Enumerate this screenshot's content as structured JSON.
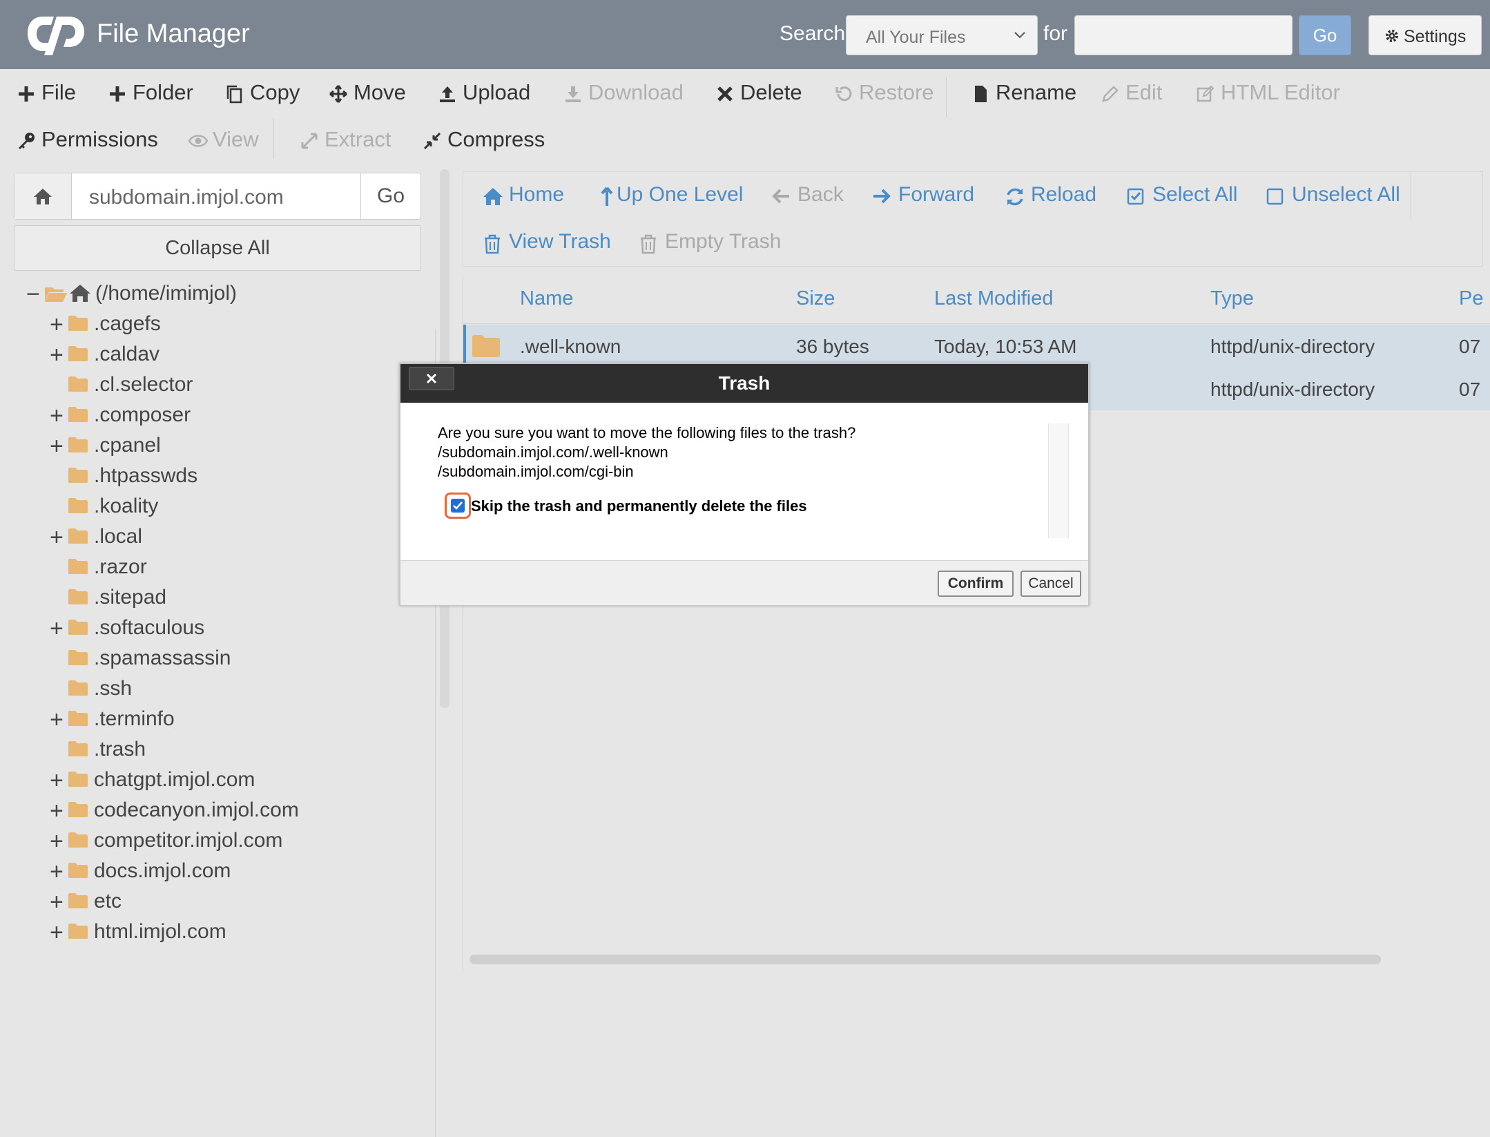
{
  "header": {
    "app_title": "File Manager",
    "search_label": "Search",
    "search_scope": "All Your Files",
    "for_label": "for",
    "search_value": "",
    "go_label": "Go",
    "settings_label": "Settings"
  },
  "toolbar": {
    "file": "File",
    "folder": "Folder",
    "copy": "Copy",
    "move": "Move",
    "upload": "Upload",
    "download": "Download",
    "delete": "Delete",
    "restore": "Restore",
    "rename": "Rename",
    "edit": "Edit",
    "html_editor": "HTML Editor",
    "permissions": "Permissions",
    "view": "View",
    "extract": "Extract",
    "compress": "Compress"
  },
  "sidebar": {
    "path_value": "subdomain.imjol.com",
    "go_label": "Go",
    "collapse_all": "Collapse All",
    "root_label": "(/home/imimjol)",
    "tree": [
      {
        "label": ".cagefs",
        "expandable": true
      },
      {
        "label": ".caldav",
        "expandable": true
      },
      {
        "label": ".cl.selector",
        "expandable": false
      },
      {
        "label": ".composer",
        "expandable": true
      },
      {
        "label": ".cpanel",
        "expandable": true
      },
      {
        "label": ".htpasswds",
        "expandable": false
      },
      {
        "label": ".koality",
        "expandable": false
      },
      {
        "label": ".local",
        "expandable": true
      },
      {
        "label": ".razor",
        "expandable": false
      },
      {
        "label": ".sitepad",
        "expandable": false
      },
      {
        "label": ".softaculous",
        "expandable": true
      },
      {
        "label": ".spamassassin",
        "expandable": false
      },
      {
        "label": ".ssh",
        "expandable": false
      },
      {
        "label": ".terminfo",
        "expandable": true
      },
      {
        "label": ".trash",
        "expandable": false
      },
      {
        "label": "chatgpt.imjol.com",
        "expandable": true
      },
      {
        "label": "codecanyon.imjol.com",
        "expandable": true
      },
      {
        "label": "competitor.imjol.com",
        "expandable": true
      },
      {
        "label": "docs.imjol.com",
        "expandable": true
      },
      {
        "label": "etc",
        "expandable": true
      },
      {
        "label": "html.imjol.com",
        "expandable": true
      }
    ]
  },
  "navbar": {
    "home": "Home",
    "up_one_level": "Up One Level",
    "back": "Back",
    "forward": "Forward",
    "reload": "Reload",
    "select_all": "Select All",
    "unselect_all": "Unselect All",
    "view_trash": "View Trash",
    "empty_trash": "Empty Trash"
  },
  "table": {
    "columns": [
      "Name",
      "Size",
      "Last Modified",
      "Type",
      "Pe"
    ],
    "rows": [
      {
        "name": ".well-known",
        "size": "36 bytes",
        "modified": "Today, 10:53 AM",
        "type": "httpd/unix-directory",
        "perms": "07"
      },
      {
        "name": "",
        "size": "",
        "modified": "",
        "type": "httpd/unix-directory",
        "perms": "07"
      }
    ]
  },
  "modal": {
    "title": "Trash",
    "message": "Are you sure you want to move the following files to the trash?",
    "files": [
      "/subdomain.imjol.com/.well-known",
      "/subdomain.imjol.com/cgi-bin"
    ],
    "skip_label": "Skip the trash and permanently delete the files",
    "skip_checked": true,
    "confirm": "Confirm",
    "cancel": "Cancel"
  },
  "colors": {
    "header_bg": "#7c8692",
    "link_blue": "#4a8cc7",
    "folder": "#e8b773",
    "selected_row": "#d2dde6"
  }
}
